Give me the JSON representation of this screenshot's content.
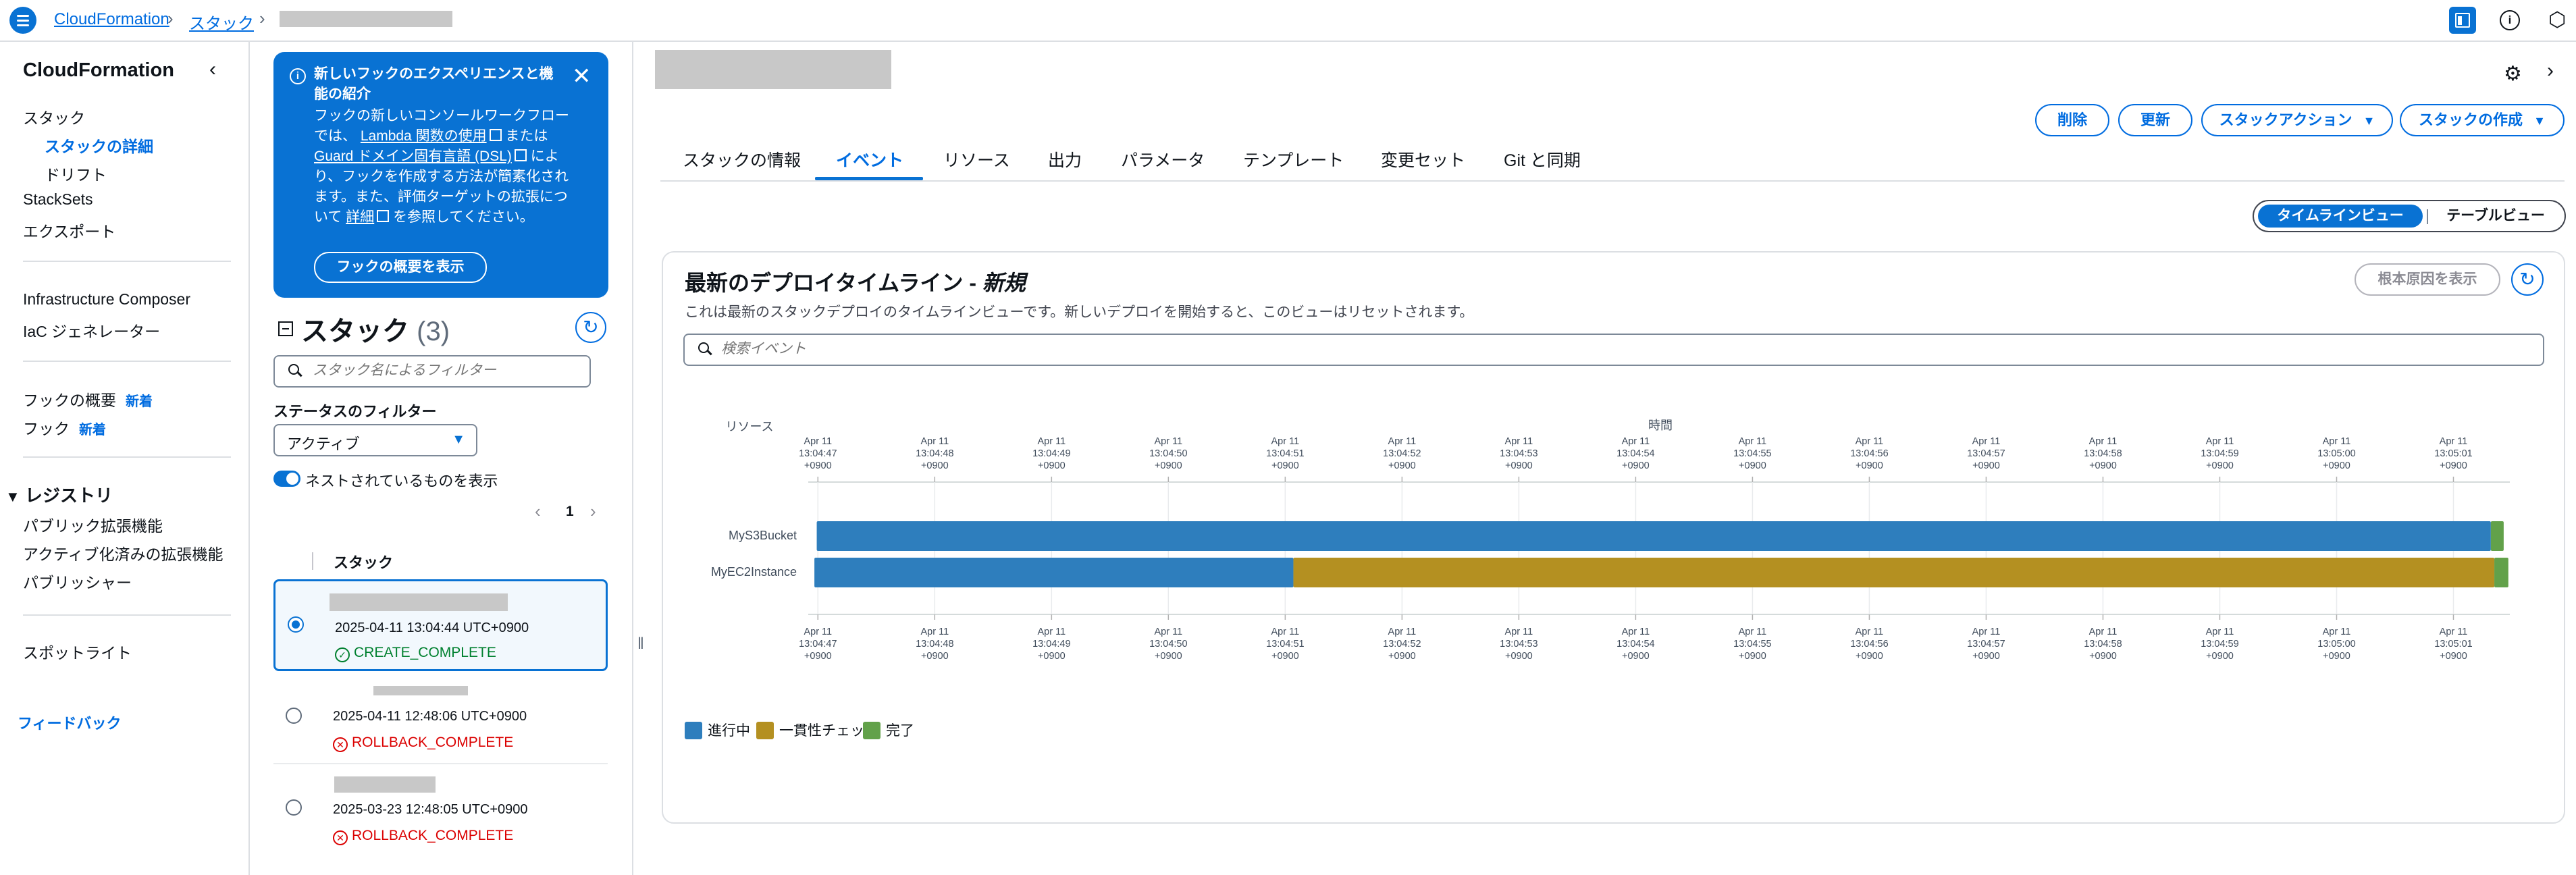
{
  "breadcrumbs": [
    "CloudFormation",
    "スタック"
  ],
  "nav": {
    "title": "CloudFormation",
    "items": [
      {
        "label": "スタック"
      },
      {
        "label": "スタックの詳細"
      },
      {
        "label": "ドリフト"
      },
      {
        "label": "StackSets"
      },
      {
        "label": "エクスポート"
      },
      {
        "label": "Infrastructure Composer"
      },
      {
        "label": "IaC ジェネレーター"
      },
      {
        "label": "フックの概要",
        "badge": "新着"
      },
      {
        "label": "フック",
        "badge": "新着"
      }
    ],
    "registry_title": "レジストリ",
    "registry_items": [
      {
        "label": "パブリック拡張機能"
      },
      {
        "label": "アクティブ化済みの拡張機能"
      },
      {
        "label": "パブリッシャー"
      }
    ],
    "spotlight": "スポットライト",
    "feedback": "フィードバック"
  },
  "flash": {
    "title": "新しいフックのエクスペリエンスと機能の紹介",
    "body_1": "フックの新しいコンソールワークフローでは、",
    "link_1": "Lambda 関数の使用",
    "body_2": "または",
    "link_2": "Guard ドメイン固有言語 (DSL)",
    "body_3": "により、フックを作成する方法が簡素化されます。また、評価ターゲットの拡張について",
    "link_3": "詳細",
    "body_4": "を参照してください。",
    "button": "フックの概要を表示"
  },
  "stacks": {
    "title": "スタック",
    "count": "(3)",
    "filter_placeholder": "スタック名によるフィルター",
    "status_filter_label": "ステータスのフィルター",
    "status_filter_value": "アクティブ",
    "nested_toggle_label": "ネストされているものを表示",
    "nested_toggle_on": true,
    "page": "1",
    "column_header": "スタック",
    "rows": [
      {
        "date": "2025-04-11 13:04:44 UTC+0900",
        "status": "CREATE_COMPLETE",
        "selected": true
      },
      {
        "date": "2025-04-11 12:48:06 UTC+0900",
        "status": "ROLLBACK_COMPLETE",
        "selected": false
      },
      {
        "date": "2025-03-23 12:48:05 UTC+0900",
        "status": "ROLLBACK_COMPLETE",
        "selected": false
      }
    ]
  },
  "actions": {
    "delete": "削除",
    "update": "更新",
    "stack_actions": "スタックアクション",
    "create_stack": "スタックの作成"
  },
  "tabs": [
    {
      "label": "スタックの情報"
    },
    {
      "label": "イベント",
      "active": true
    },
    {
      "label": "リソース"
    },
    {
      "label": "出力"
    },
    {
      "label": "パラメータ"
    },
    {
      "label": "テンプレート"
    },
    {
      "label": "変更セット"
    },
    {
      "label": "Git と同期"
    }
  ],
  "view_toggle": {
    "timeline": "タイムラインビュー",
    "table": "テーブルビュー",
    "active": "timeline"
  },
  "timeline": {
    "title": "最新のデプロイタイムライン - ",
    "title_status": "新規",
    "description": "これは最新のスタックデプロイのタイムラインビューです。新しいデプロイを開始すると、このビューはリセットされます。",
    "root_cause_button": "根本原因を表示",
    "search_placeholder": "検索イベント"
  },
  "chart_data": {
    "type": "gantt",
    "row_axis_label": "リソース",
    "time_axis_label": "時間",
    "tick_labels": [
      [
        "Apr 11",
        "13:04:47",
        "+0900"
      ],
      [
        "Apr 11",
        "13:04:48",
        "+0900"
      ],
      [
        "Apr 11",
        "13:04:49",
        "+0900"
      ],
      [
        "Apr 11",
        "13:04:50",
        "+0900"
      ],
      [
        "Apr 11",
        "13:04:51",
        "+0900"
      ],
      [
        "Apr 11",
        "13:04:52",
        "+0900"
      ],
      [
        "Apr 11",
        "13:04:53",
        "+0900"
      ],
      [
        "Apr 11",
        "13:04:54",
        "+0900"
      ],
      [
        "Apr 11",
        "13:04:55",
        "+0900"
      ],
      [
        "Apr 11",
        "13:04:56",
        "+0900"
      ],
      [
        "Apr 11",
        "13:04:57",
        "+0900"
      ],
      [
        "Apr 11",
        "13:04:58",
        "+0900"
      ],
      [
        "Apr 11",
        "13:04:59",
        "+0900"
      ],
      [
        "Apr 11",
        "13:05:00",
        "+0900"
      ],
      [
        "Apr 11",
        "13:05:01",
        "+0900"
      ]
    ],
    "tick_seconds": [
      47,
      48,
      49,
      50,
      51,
      52,
      53,
      54,
      55,
      56,
      57,
      58,
      59,
      60,
      61
    ],
    "x_range_seconds": [
      46.9,
      61.5
    ],
    "resources": [
      {
        "name": "MyS3Bucket",
        "segments": [
          {
            "phase": "progress",
            "start": 46.99,
            "end": 61.32
          },
          {
            "phase": "complete",
            "start": 61.32,
            "end": 61.43
          }
        ]
      },
      {
        "name": "MyEC2Instance",
        "segments": [
          {
            "phase": "progress",
            "start": 46.97,
            "end": 51.07
          },
          {
            "phase": "consistency",
            "start": 51.07,
            "end": 61.35
          },
          {
            "phase": "complete",
            "start": 61.35,
            "end": 61.47
          }
        ]
      }
    ],
    "legend": [
      {
        "phase": "progress",
        "label": "進行中",
        "color": "#2e7ebd"
      },
      {
        "phase": "consistency",
        "label": "一貫性チェッ",
        "color": "#b49021"
      },
      {
        "phase": "complete",
        "label": "完了",
        "color": "#62a14a"
      }
    ]
  }
}
